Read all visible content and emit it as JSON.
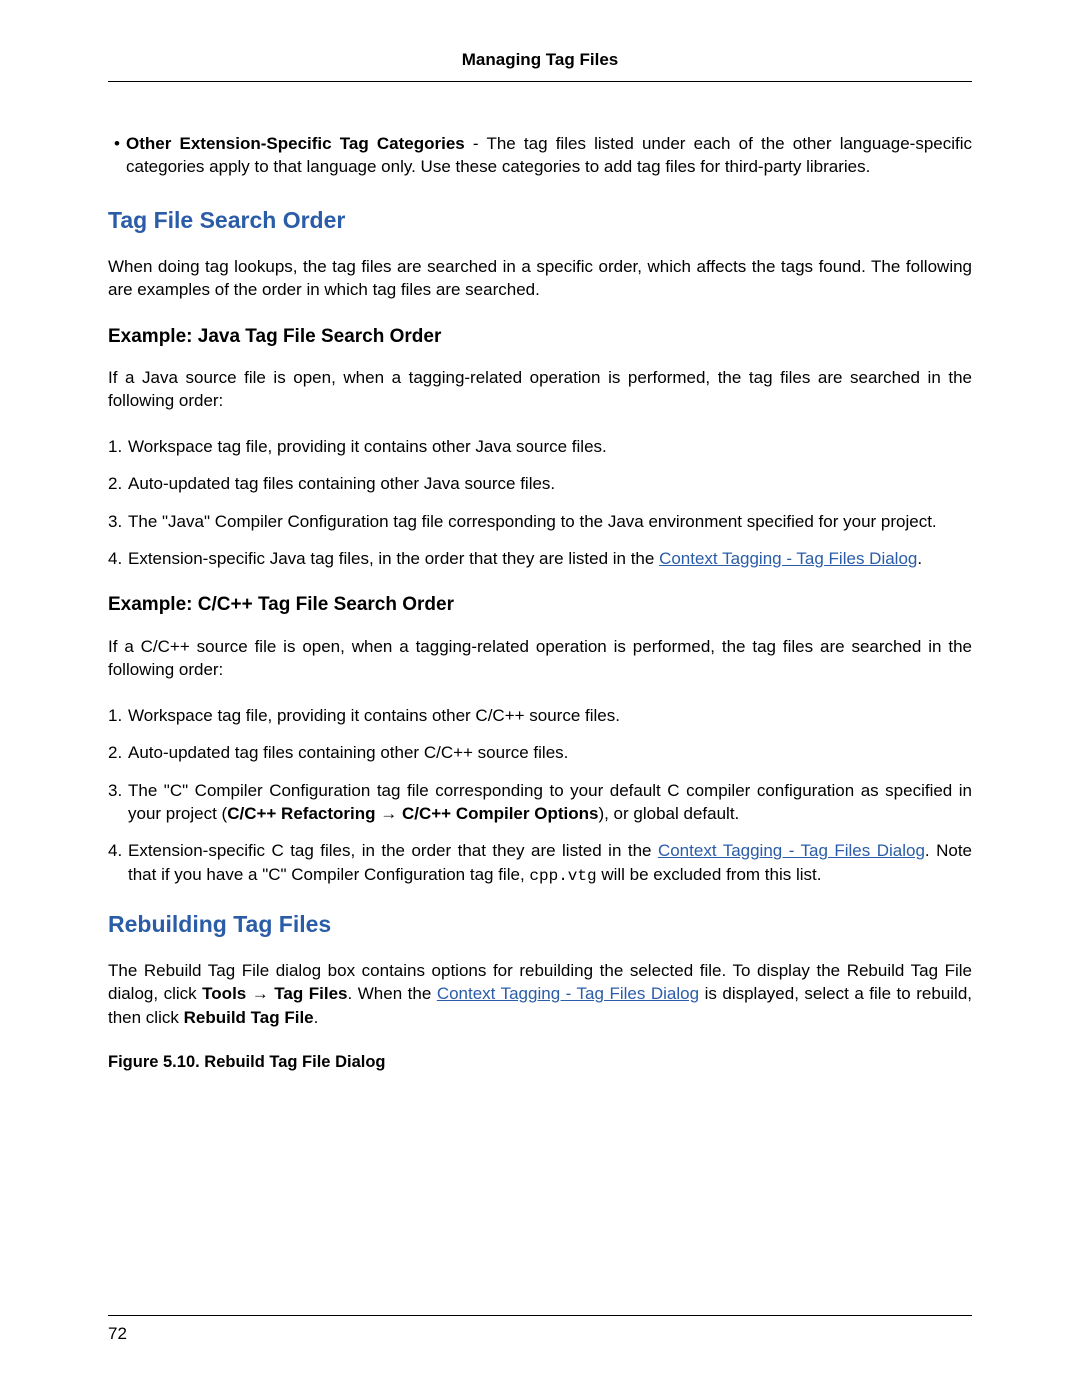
{
  "header": {
    "title": "Managing Tag Files"
  },
  "bullet1": {
    "label": "Other Extension-Specific Tag Categories",
    "text": " - The tag files listed under each of the other language-specific categories apply to that language only. Use these categories to add tag files for third-party libraries."
  },
  "section1": {
    "heading": "Tag File Search Order",
    "intro": "When doing tag lookups, the tag files are searched in a specific order, which affects the tags found. The following are examples of the order in which tag files are searched.",
    "sub1": {
      "heading": "Example: Java Tag File Search Order",
      "intro": "If a Java source file is open, when a tagging-related operation is performed, the tag files are searched in the following order:",
      "items": {
        "i1": "Workspace tag file, providing it contains other Java source files.",
        "i2": "Auto-updated tag files containing other Java source files.",
        "i3": "The \"Java\" Compiler Configuration tag file corresponding to the Java environment specified for your project.",
        "i4_pre": "Extension-specific Java tag files, in the order that they are listed in the ",
        "i4_link": "Context Tagging - Tag Files Dialog",
        "i4_post": "."
      }
    },
    "sub2": {
      "heading": "Example: C/C++ Tag File Search Order",
      "intro": "If a C/C++ source file is open, when a tagging-related operation is performed, the tag files are searched in the following order:",
      "items": {
        "i1": "Workspace tag file, providing it contains other C/C++ source files.",
        "i2": "Auto-updated tag files containing other C/C++ source files.",
        "i3_pre": "The \"C\" Compiler Configuration tag file corresponding to your default C compiler configuration as specified in your project (",
        "i3_b1": "C/C++ Refactoring",
        "i3_arrow": " → ",
        "i3_b2": "C/C++ Compiler Options",
        "i3_post": "), or global default.",
        "i4_pre": "Extension-specific C tag files, in the order that they are listed in the ",
        "i4_link": "Context Tagging - Tag Files Dialog",
        "i4_mid": ". Note that if you have a \"C\" Compiler Configuration tag file, ",
        "i4_code": "cpp.vtg",
        "i4_post": " will be excluded from this list."
      }
    }
  },
  "section2": {
    "heading": "Rebuilding Tag Files",
    "para_pre": "The Rebuild Tag File dialog box contains options for rebuilding the selected file. To display the Rebuild Tag File dialog, click ",
    "para_b1": "Tools",
    "para_arrow": " → ",
    "para_b2": "Tag Files",
    "para_mid": ". When the ",
    "para_link": "Context Tagging - Tag Files Dialog",
    "para_mid2": " is displayed, select a file to rebuild, then click ",
    "para_b3": "Rebuild Tag File",
    "para_post": ".",
    "figure_caption": "Figure 5.10.  Rebuild Tag File Dialog"
  },
  "footer": {
    "page_number": "72"
  }
}
